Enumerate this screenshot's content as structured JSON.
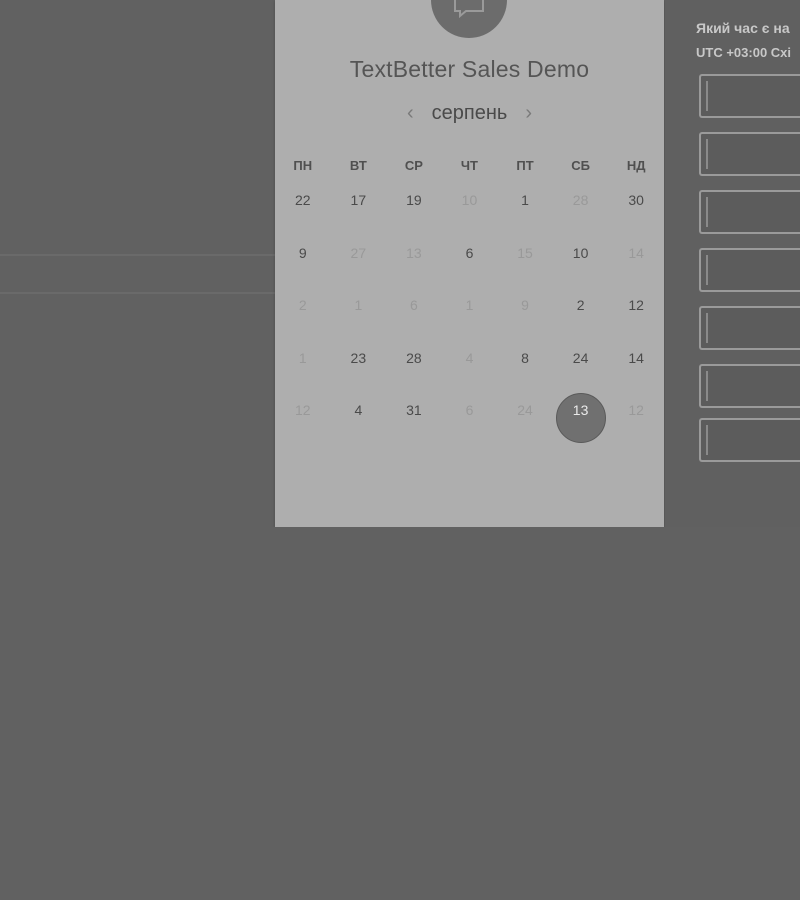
{
  "event": {
    "title": "TextBetter Sales Demo"
  },
  "calendar": {
    "month": "серпень",
    "prev_icon": "chevron-left-icon",
    "next_icon": "chevron-right-icon",
    "weekdays": [
      "ПН",
      "ВТ",
      "СР",
      "ЧТ",
      "ПТ",
      "СБ",
      "НД"
    ],
    "weeks": [
      [
        {
          "label": "22",
          "enabled": true
        },
        {
          "label": "17",
          "enabled": true
        },
        {
          "label": "19",
          "enabled": true
        },
        {
          "label": "10",
          "enabled": false
        },
        {
          "label": "1",
          "enabled": true
        },
        {
          "label": "28",
          "enabled": false
        },
        {
          "label": "30",
          "enabled": true
        }
      ],
      [
        {
          "label": "9",
          "enabled": true
        },
        {
          "label": "27",
          "enabled": false
        },
        {
          "label": "13",
          "enabled": false
        },
        {
          "label": "6",
          "enabled": true
        },
        {
          "label": "15",
          "enabled": false
        },
        {
          "label": "10",
          "enabled": true
        },
        {
          "label": "14",
          "enabled": false
        }
      ],
      [
        {
          "label": "2",
          "enabled": false
        },
        {
          "label": "1",
          "enabled": false
        },
        {
          "label": "6",
          "enabled": false
        },
        {
          "label": "1",
          "enabled": false
        },
        {
          "label": "9",
          "enabled": false
        },
        {
          "label": "2",
          "enabled": true
        },
        {
          "label": "12",
          "enabled": true
        }
      ],
      [
        {
          "label": "1",
          "enabled": false
        },
        {
          "label": "23",
          "enabled": true
        },
        {
          "label": "28",
          "enabled": true
        },
        {
          "label": "4",
          "enabled": false
        },
        {
          "label": "8",
          "enabled": true
        },
        {
          "label": "24",
          "enabled": true
        },
        {
          "label": "14",
          "enabled": true
        }
      ],
      [
        {
          "label": "12",
          "enabled": false
        },
        {
          "label": "4",
          "enabled": true
        },
        {
          "label": "31",
          "enabled": true
        },
        {
          "label": "6",
          "enabled": false
        },
        {
          "label": "24",
          "enabled": false
        },
        {
          "label": "13",
          "enabled": true,
          "selected": true
        },
        {
          "label": "12",
          "enabled": false
        }
      ]
    ]
  },
  "timezone": {
    "question": "Який час є на",
    "value": "UTC +03:00 Схі"
  },
  "slots_count": 7,
  "colors": {
    "page_bg": "#616161",
    "card_bg": "#aeaeae",
    "selected_day": "#707070"
  }
}
